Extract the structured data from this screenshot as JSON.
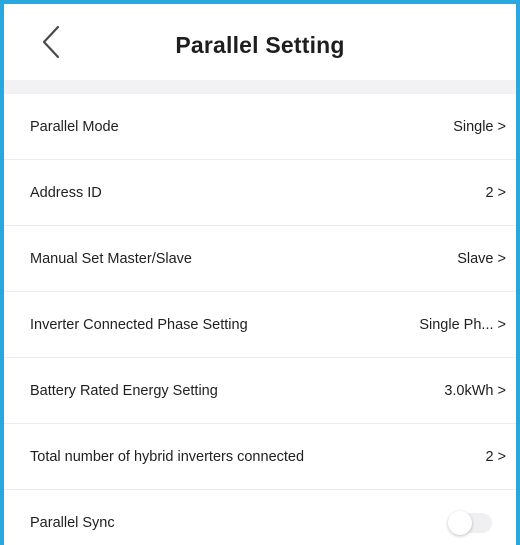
{
  "header": {
    "title": "Parallel Setting",
    "back_icon": "chevron-left-icon"
  },
  "rows": [
    {
      "label": "Parallel Mode",
      "value": "Single >"
    },
    {
      "label": "Address ID",
      "value": "2 >"
    },
    {
      "label": "Manual Set Master/Slave",
      "value": "Slave >"
    },
    {
      "label": "Inverter Connected Phase Setting",
      "value": "Single Ph... >"
    },
    {
      "label": "Battery Rated Energy Setting",
      "value": "3.0kWh >"
    },
    {
      "label": "Total number of hybrid inverters connected",
      "value": "2 >"
    }
  ],
  "sync": {
    "label": "Parallel Sync",
    "enabled": false
  },
  "colors": {
    "frame_border": "#29a8e0",
    "band": "#f2f2f4",
    "text": "#1f1f1f"
  }
}
